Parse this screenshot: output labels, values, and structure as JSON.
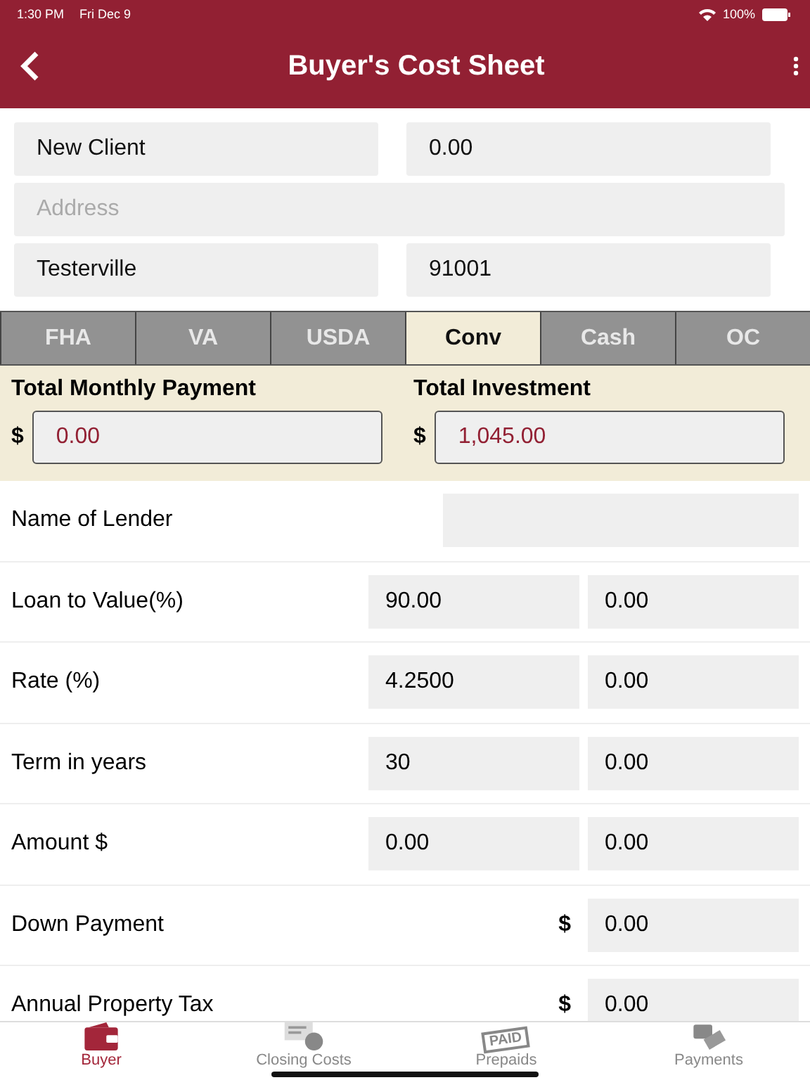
{
  "status_bar": {
    "time": "1:30 PM",
    "date": "Fri Dec 9",
    "battery": "100%"
  },
  "header": {
    "title": "Buyer's Cost Sheet"
  },
  "client": {
    "name": "New Client",
    "amount": "0.00",
    "address_placeholder": "Address",
    "city": "Testerville",
    "zip": "91001"
  },
  "tabs": [
    {
      "label": "FHA",
      "selected": false
    },
    {
      "label": "VA",
      "selected": false
    },
    {
      "label": "USDA",
      "selected": false
    },
    {
      "label": "Conv",
      "selected": true
    },
    {
      "label": "Cash",
      "selected": false
    },
    {
      "label": "OC",
      "selected": false
    }
  ],
  "totals": [
    {
      "label": "Total Monthly Payment",
      "currency": "$",
      "value": "0.00"
    },
    {
      "label": "Total Investment",
      "currency": "$",
      "value": "1,045.00"
    }
  ],
  "rows": [
    {
      "kind": "single",
      "label": "Name of Lender"
    },
    {
      "kind": "double",
      "label": "Loan to Value(%)",
      "values": [
        "90.00",
        "0.00"
      ]
    },
    {
      "kind": "double",
      "label": "Rate (%)",
      "values": [
        "4.2500",
        "0.00"
      ]
    },
    {
      "kind": "double",
      "label": "Term in years",
      "values": [
        "30",
        "0.00"
      ]
    },
    {
      "kind": "double",
      "label": "Amount $",
      "values": [
        "0.00",
        "0.00"
      ]
    },
    {
      "kind": "dollar",
      "label": "Down Payment",
      "currency": "$",
      "values": [
        "0.00"
      ]
    },
    {
      "kind": "dollar",
      "label": "Annual Property Tax",
      "currency": "$",
      "values": [
        "0.00"
      ]
    }
  ],
  "bottom_tabs": [
    {
      "label": "Buyer",
      "kind": "wallet",
      "selected": true
    },
    {
      "label": "Closing Costs",
      "kind": "check",
      "selected": false
    },
    {
      "label": "Prepaids",
      "kind": "stamp",
      "stamp_text": "PAID",
      "selected": false
    },
    {
      "label": "Payments",
      "kind": "cards",
      "selected": false
    }
  ]
}
